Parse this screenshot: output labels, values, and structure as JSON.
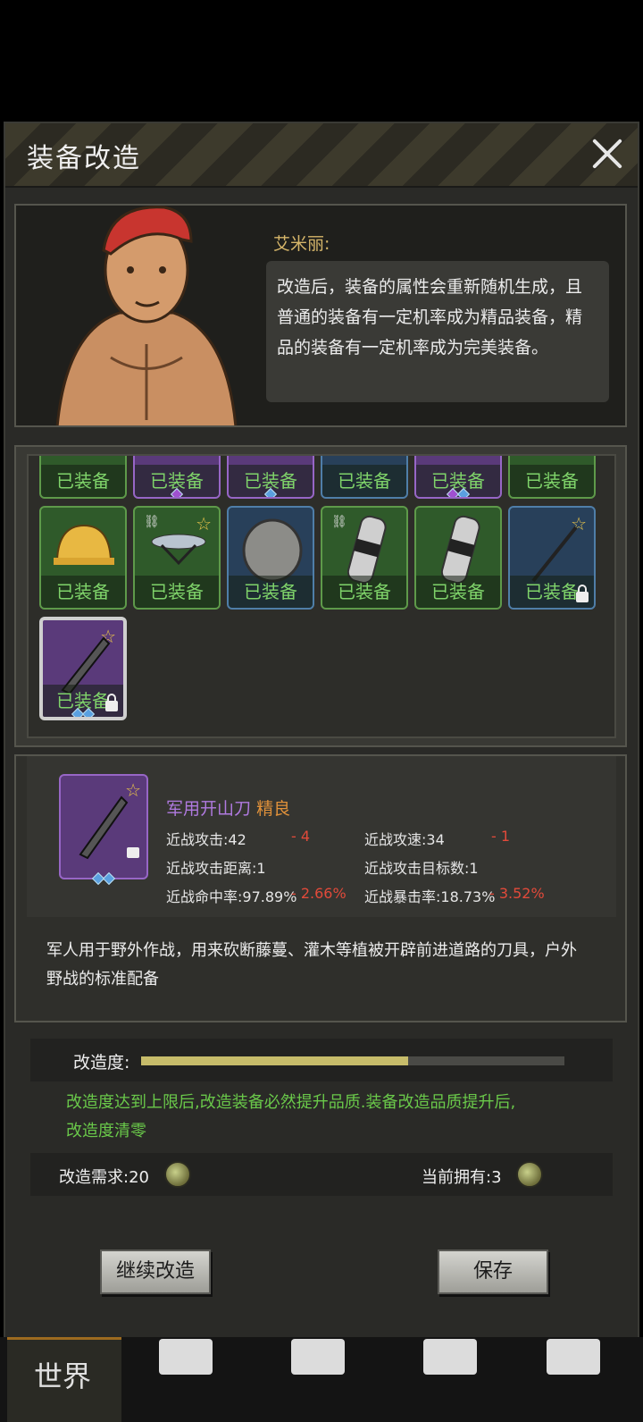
{
  "dialog": {
    "title": "装备改造"
  },
  "npc": {
    "name": "艾米丽:",
    "speech": "改造后，装备的属性会重新随机生成，且普通的装备有一定机率成为精品装备，精品的装备有一定机率成为完美装备。"
  },
  "inventory": {
    "equipped_label": "已装备",
    "rows": [
      [
        "green",
        "purple",
        "purple",
        "blue",
        "purple",
        "green"
      ],
      [
        "green",
        "green",
        "blue",
        "green",
        "green",
        "blue"
      ],
      [
        "purple"
      ]
    ]
  },
  "item": {
    "name": "军用开山刀",
    "quality": "精良",
    "stats": [
      {
        "label": "近战攻击:42",
        "delta": "- 4"
      },
      {
        "label": "近战攻速:34",
        "delta": "- 1"
      },
      {
        "label": "近战攻击距离:1",
        "delta": ""
      },
      {
        "label": "近战攻击目标数:1",
        "delta": ""
      },
      {
        "label": "近战命中率:97.89%",
        "delta": "- 2.66%"
      },
      {
        "label": "近战暴击率:18.73%",
        "delta": "- 3.52%"
      }
    ],
    "description": "军人用于野外作战，用来砍断藤蔓、灌木等植被开辟前进道路的刀具，户外野战的标准配备"
  },
  "refine": {
    "label": "改造度:",
    "progress": 0.63,
    "note": "改造度达到上限后,改造装备必然提升品质.装备改造品质提升后,改造度清零"
  },
  "cost": {
    "required": "改造需求:20",
    "owned": "当前拥有:3"
  },
  "buttons": {
    "continue": "继续改造",
    "save": "保存"
  },
  "nav": {
    "world": "世界"
  },
  "colors": {
    "accent_green": "#6ac94a",
    "quality_orange": "#e0913a",
    "delta_red": "#e24a3a"
  }
}
